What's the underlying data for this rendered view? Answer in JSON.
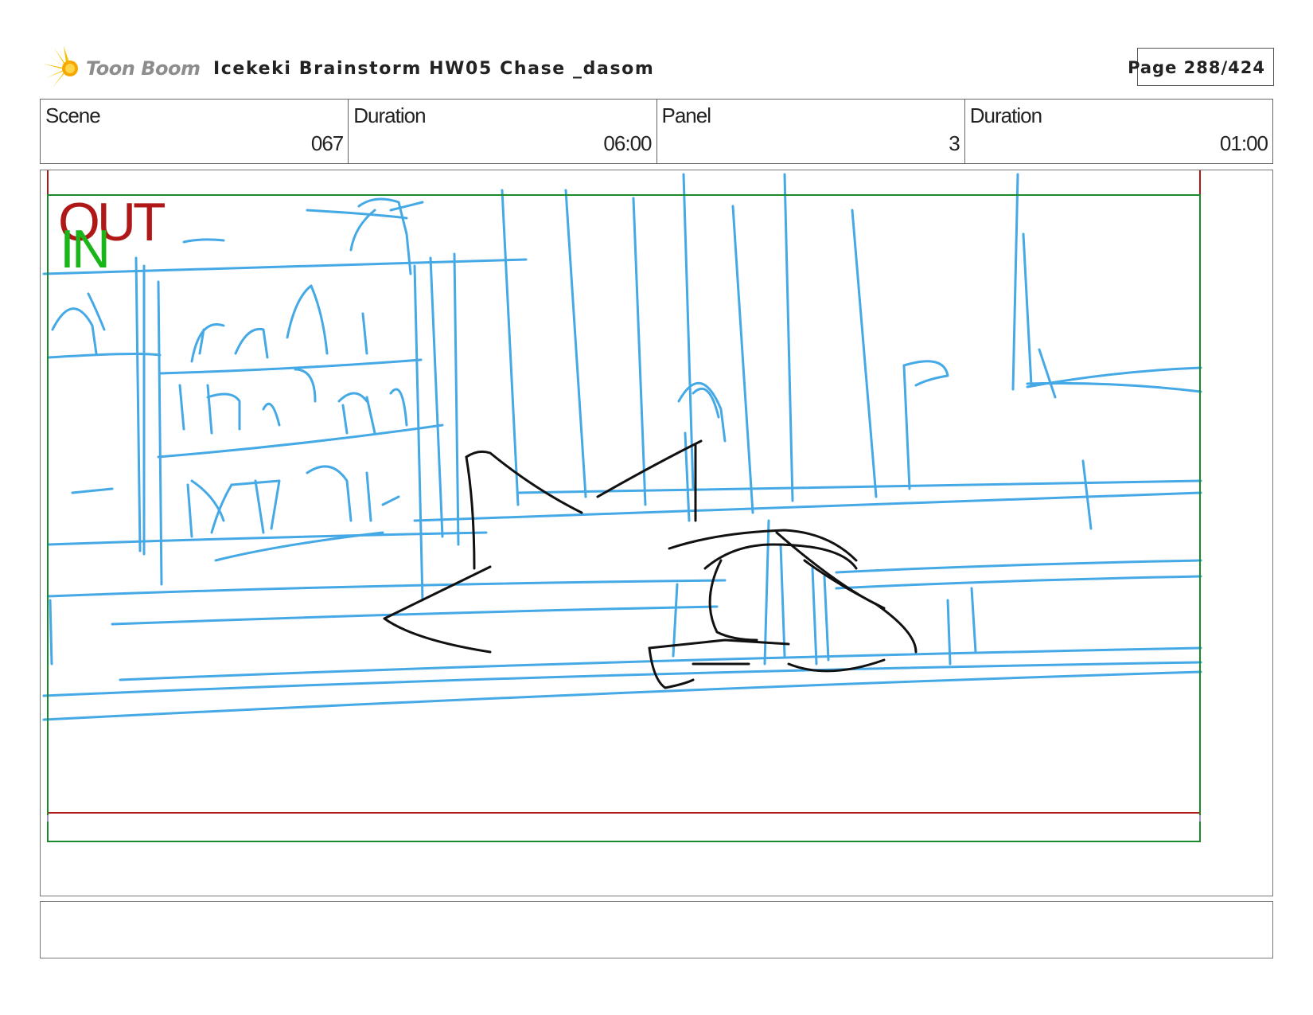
{
  "header": {
    "logo_text": "Toon Boom",
    "title": "Icekeki Brainstorm HW05 Chase _dasom",
    "page_label": "Page 288/424"
  },
  "info": [
    {
      "label": "Scene",
      "value": "067"
    },
    {
      "label": "Duration",
      "value": "06:00"
    },
    {
      "label": "Panel",
      "value": "3"
    },
    {
      "label": "Duration",
      "value": "01:00"
    }
  ],
  "panel": {
    "out_label": "OUT",
    "in_label": "IN"
  },
  "caption": {
    "text": ""
  },
  "colors": {
    "sketch_blue": "#45a9e6",
    "ink_black": "#111111",
    "out_frame_red": "#b01818",
    "in_frame_green": "#1a8a2a",
    "logo_yellow": "#f5c200"
  }
}
